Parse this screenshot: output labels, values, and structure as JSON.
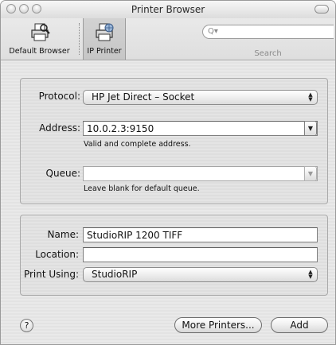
{
  "window": {
    "title": "Printer Browser"
  },
  "toolbar": {
    "default_browser_label": "Default Browser",
    "ip_printer_label": "IP Printer",
    "search_placeholder": "",
    "search_label": "Search"
  },
  "protocol": {
    "label": "Protocol:",
    "value": "HP Jet Direct – Socket"
  },
  "address": {
    "label": "Address:",
    "value": "10.0.2.3:9150",
    "hint": "Valid and complete address."
  },
  "queue": {
    "label": "Queue:",
    "value": "",
    "hint": "Leave blank for default queue."
  },
  "name": {
    "label": "Name:",
    "value": "StudioRIP 1200 TIFF"
  },
  "location": {
    "label": "Location:",
    "value": ""
  },
  "print_using": {
    "label": "Print Using:",
    "value": "StudioRIP"
  },
  "buttons": {
    "help": "?",
    "more_printers": "More Printers...",
    "add": "Add"
  },
  "icons": {
    "default_browser": "printer-magnifier-icon",
    "ip_printer": "printer-globe-icon",
    "search": "magnifier-icon"
  }
}
